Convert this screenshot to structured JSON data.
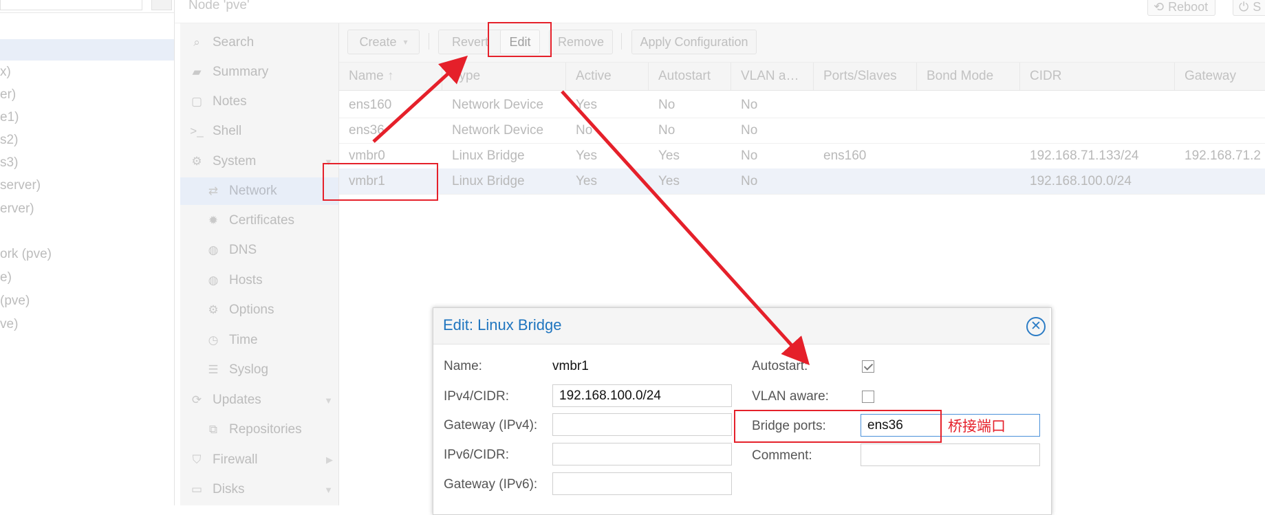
{
  "tree": {
    "items": [
      "x)",
      "er)",
      "e1)",
      "s2)",
      "s3)",
      "server)",
      "erver)",
      "ork (pve)",
      "e)",
      " (pve)",
      "ve)"
    ]
  },
  "header": {
    "node_title": "Node 'pve'",
    "reboot_label": "Reboot",
    "shutdown_label": "S"
  },
  "menu": {
    "items": [
      {
        "label": "Search",
        "icon": "search-icon"
      },
      {
        "label": "Summary",
        "icon": "book-icon"
      },
      {
        "label": "Notes",
        "icon": "notes-icon"
      },
      {
        "label": "Shell",
        "icon": "terminal-icon"
      },
      {
        "label": "System",
        "icon": "cogs-icon"
      },
      {
        "label": "Network",
        "icon": "exchange-icon"
      },
      {
        "label": "Certificates",
        "icon": "certificate-icon"
      },
      {
        "label": "DNS",
        "icon": "globe-icon"
      },
      {
        "label": "Hosts",
        "icon": "globe-icon"
      },
      {
        "label": "Options",
        "icon": "gear-icon"
      },
      {
        "label": "Time",
        "icon": "clock-icon"
      },
      {
        "label": "Syslog",
        "icon": "list-icon"
      },
      {
        "label": "Updates",
        "icon": "refresh-icon"
      },
      {
        "label": "Repositories",
        "icon": "files-icon"
      },
      {
        "label": "Firewall",
        "icon": "shield-icon"
      },
      {
        "label": "Disks",
        "icon": "hdd-icon"
      }
    ]
  },
  "toolbar": {
    "create_label": "Create",
    "revert_label": "Revert",
    "edit_label": "Edit",
    "remove_label": "Remove",
    "apply_label": "Apply Configuration"
  },
  "grid": {
    "columns": [
      "Name",
      "Type",
      "Active",
      "Autostart",
      "VLAN a…",
      "Ports/Slaves",
      "Bond Mode",
      "CIDR",
      "Gateway"
    ],
    "rows": [
      [
        "ens160",
        "Network Device",
        "Yes",
        "No",
        "No",
        "",
        "",
        "",
        ""
      ],
      [
        "ens36",
        "Network Device",
        "No",
        "No",
        "No",
        "",
        "",
        "",
        ""
      ],
      [
        "vmbr0",
        "Linux Bridge",
        "Yes",
        "Yes",
        "No",
        "ens160",
        "",
        "192.168.71.133/24",
        "192.168.71.2"
      ],
      [
        "vmbr1",
        "Linux Bridge",
        "Yes",
        "Yes",
        "No",
        "",
        "",
        "192.168.100.0/24",
        ""
      ]
    ]
  },
  "dialog": {
    "title": "Edit: Linux Bridge",
    "name_label": "Name:",
    "name_value": "vmbr1",
    "ipv4_label": "IPv4/CIDR:",
    "ipv4_value": "192.168.100.0/24",
    "gw4_label": "Gateway (IPv4):",
    "gw4_value": "",
    "ipv6_label": "IPv6/CIDR:",
    "ipv6_value": "",
    "gw6_label": "Gateway (IPv6):",
    "gw6_value": "",
    "autostart_label": "Autostart:",
    "autostart_checked": true,
    "vlan_label": "VLAN aware:",
    "vlan_checked": false,
    "ports_label": "Bridge ports:",
    "ports_value": "ens36",
    "comment_label": "Comment:",
    "comment_value": ""
  },
  "annotation": {
    "text": "桥接端口",
    "color": "#e5202a"
  },
  "colors": {
    "accent": "#1f75bf",
    "selection": "#e8eef8"
  }
}
